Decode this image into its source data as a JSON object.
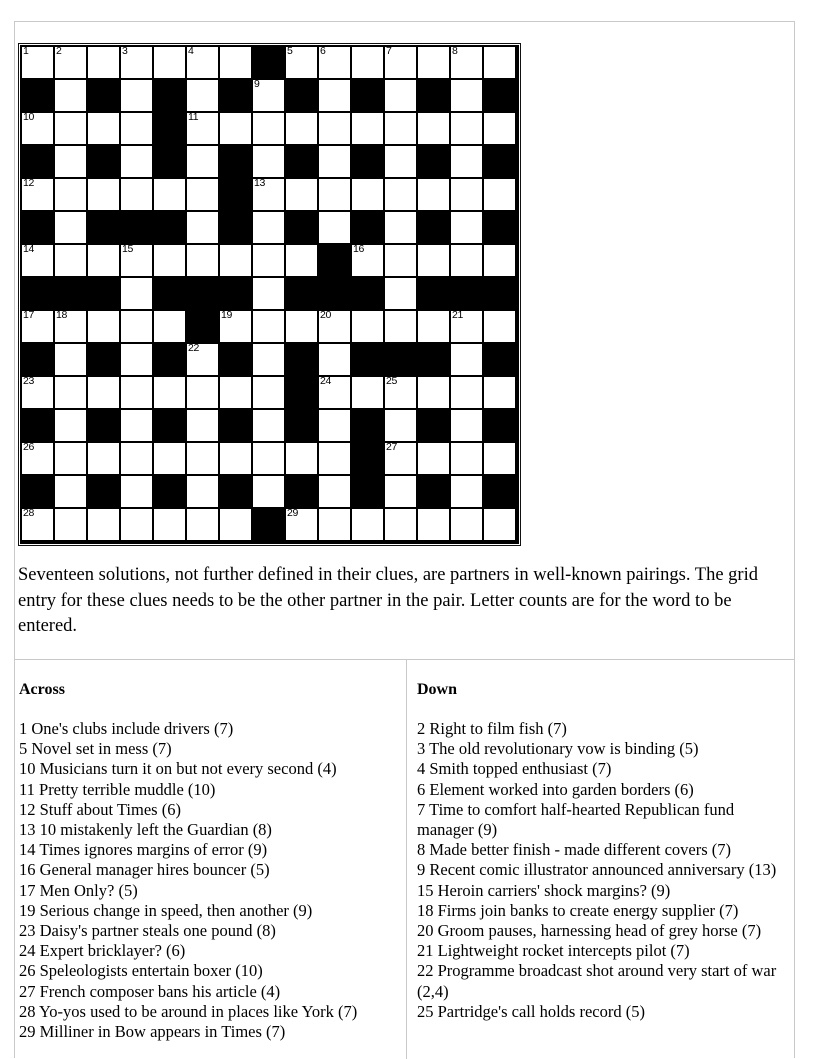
{
  "puzzle": {
    "preamble": "Seventeen solutions, not further defined in their clues, are partners in well-known pairings. The grid entry for these clues needs to be the other partner in the pair. Letter counts are for the word to be entered.",
    "grid": {
      "size": 15,
      "cells": [
        [
          1,
          1,
          1,
          1,
          1,
          1,
          1,
          0,
          1,
          1,
          1,
          1,
          1,
          1,
          1
        ],
        [
          0,
          1,
          0,
          1,
          0,
          1,
          0,
          1,
          0,
          1,
          0,
          1,
          0,
          1,
          0
        ],
        [
          1,
          1,
          1,
          1,
          0,
          1,
          1,
          1,
          1,
          1,
          1,
          1,
          1,
          1,
          1
        ],
        [
          0,
          1,
          0,
          1,
          0,
          1,
          0,
          1,
          0,
          1,
          0,
          1,
          0,
          1,
          0
        ],
        [
          1,
          1,
          1,
          1,
          1,
          1,
          0,
          1,
          1,
          1,
          1,
          1,
          1,
          1,
          1
        ],
        [
          0,
          1,
          0,
          0,
          0,
          1,
          0,
          1,
          0,
          1,
          0,
          1,
          0,
          1,
          0
        ],
        [
          1,
          1,
          1,
          1,
          1,
          1,
          1,
          1,
          1,
          0,
          1,
          1,
          1,
          1,
          1
        ],
        [
          0,
          0,
          0,
          1,
          0,
          0,
          0,
          1,
          0,
          0,
          0,
          1,
          0,
          0,
          0
        ],
        [
          1,
          1,
          1,
          1,
          1,
          0,
          1,
          1,
          1,
          1,
          1,
          1,
          1,
          1,
          1
        ],
        [
          0,
          1,
          0,
          1,
          0,
          1,
          0,
          1,
          0,
          1,
          0,
          0,
          0,
          1,
          0
        ],
        [
          1,
          1,
          1,
          1,
          1,
          1,
          1,
          1,
          0,
          1,
          1,
          1,
          1,
          1,
          1
        ],
        [
          0,
          1,
          0,
          1,
          0,
          1,
          0,
          1,
          0,
          1,
          0,
          1,
          0,
          1,
          0
        ],
        [
          1,
          1,
          1,
          1,
          1,
          1,
          1,
          1,
          1,
          1,
          0,
          1,
          1,
          1,
          1
        ],
        [
          0,
          1,
          0,
          1,
          0,
          1,
          0,
          1,
          0,
          1,
          0,
          1,
          0,
          1,
          0
        ],
        [
          1,
          1,
          1,
          1,
          1,
          1,
          1,
          0,
          1,
          1,
          1,
          1,
          1,
          1,
          1
        ]
      ],
      "numbers": {
        "0-0": "1",
        "0-1": "2",
        "0-3": "3",
        "0-5": "4",
        "0-8": "5",
        "0-9": "6",
        "0-11": "7",
        "0-13": "8",
        "1-7": "9",
        "2-0": "10",
        "2-5": "11",
        "4-0": "12",
        "4-7": "13",
        "6-0": "14",
        "6-3": "15",
        "6-10": "16",
        "8-0": "17",
        "8-1": "18",
        "8-6": "19",
        "8-9": "20",
        "8-13": "21",
        "9-5": "22",
        "10-0": "23",
        "10-9": "24",
        "10-11": "25",
        "12-0": "26",
        "12-11": "27",
        "14-0": "28",
        "14-8": "29"
      }
    },
    "across": {
      "heading": "Across",
      "clues": [
        "1 One's clubs include drivers (7)",
        "5 Novel set in mess (7)",
        "10 Musicians turn it on but not every second (4)",
        "11 Pretty terrible muddle (10)",
        "12 Stuff about Times (6)",
        "13 10 mistakenly left the Guardian (8)",
        "14 Times ignores margins of error (9)",
        "16 General manager hires bouncer (5)",
        "17 Men Only? (5)",
        "19 Serious change in speed, then another (9)",
        "23 Daisy's partner steals one pound (8)",
        "24 Expert bricklayer? (6)",
        "26 Speleologists entertain boxer (10)",
        "27 French composer bans his article (4)",
        "28 Yo-yos used to be around in places like York (7)",
        "29 Milliner in Bow appears in Times (7)"
      ]
    },
    "down": {
      "heading": "Down",
      "clues": [
        "2 Right to film fish (7)",
        "3 The old revolutionary vow is binding (5)",
        "4 Smith topped enthusiast (7)",
        "6 Element worked into garden borders (6)",
        "7 Time to comfort half-hearted Republican fund manager (9)",
        "8 Made better finish - made different covers (7)",
        "9 Recent comic illustrator announced anniversary (13)",
        "15 Heroin carriers' shock margins? (9)",
        "18 Firms join banks to create energy supplier (7)",
        "20 Groom pauses, harnessing head of grey horse (7)",
        "21 Lightweight rocket intercepts pilot (7)",
        "22 Programme broadcast shot around very start of war (2,4)",
        "25 Partridge's call holds record (5)"
      ]
    }
  }
}
